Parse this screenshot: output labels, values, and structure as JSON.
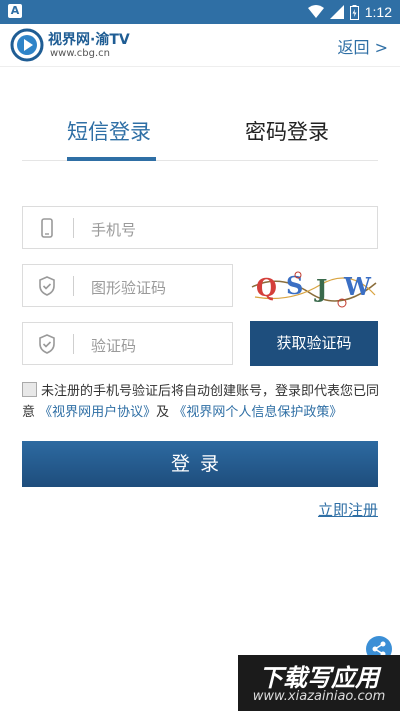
{
  "status_bar": {
    "app_badge": "A",
    "time": "1:12"
  },
  "header": {
    "logo_title": "视界网·渝TV",
    "logo_url": "www.cbg.cn",
    "back_label": "返回 >"
  },
  "tabs": [
    {
      "label": "短信登录",
      "active": true
    },
    {
      "label": "密码登录",
      "active": false
    }
  ],
  "form": {
    "phone_placeholder": "手机号",
    "captcha_placeholder": "图形验证码",
    "captcha_text": "QSJW",
    "code_placeholder": "验证码",
    "get_code_label": "获取验证码"
  },
  "agreement": {
    "text_1": "未注册的手机号验证后将自动创建账号，登录即代表您已同意",
    "link_1": "《视界网用户协议》",
    "and": "及",
    "link_2": "《视界网个人信息保护政策》"
  },
  "login_label": "登录",
  "register_label": "立即注册",
  "watermark": {
    "title": "下载写应用",
    "url": "www.xiazainiao.com"
  },
  "colors": {
    "accent": "#2f6fa5",
    "button_dark": "#1e4e7d"
  }
}
